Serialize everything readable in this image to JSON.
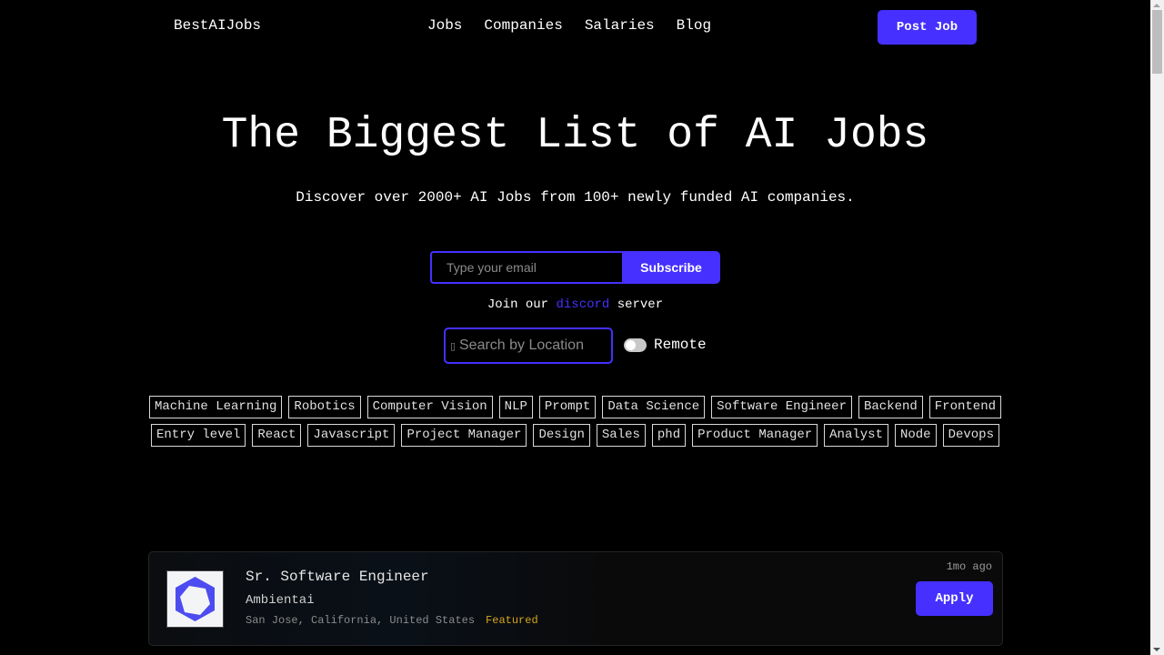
{
  "header": {
    "logo": "BestAIJobs",
    "nav": [
      {
        "label": "Jobs"
      },
      {
        "label": "Companies"
      },
      {
        "label": "Salaries"
      },
      {
        "label": "Blog"
      }
    ],
    "post_job_label": "Post Job"
  },
  "hero": {
    "title": "The Biggest List of AI Jobs",
    "subtitle": "Discover over 2000+ AI Jobs from 100+ newly funded AI companies."
  },
  "subscribe": {
    "email_placeholder": "Type your email",
    "email_value": "",
    "button_label": "Subscribe"
  },
  "discord": {
    "prefix": "Join our",
    "link": "discord",
    "suffix": "server"
  },
  "location_search": {
    "icon": "map-marker-icon",
    "placeholder": "Search by Location",
    "value": ""
  },
  "remote_toggle": {
    "label": "Remote",
    "checked": false
  },
  "tags": {
    "row1": [
      "Machine Learning",
      "Robotics",
      "Computer Vision",
      "NLP",
      "Prompt",
      "Data Science",
      "Software Engineer",
      "Backend",
      "Frontend"
    ],
    "row2": [
      "Entry level",
      "React",
      "Javascript",
      "Project Manager",
      "Design",
      "Sales",
      "phd",
      "Product Manager",
      "Analyst",
      "Node",
      "Devops"
    ]
  },
  "jobs": [
    {
      "title": "Sr. Software Engineer",
      "company": "Ambientai",
      "location": "San Jose, California, United States",
      "badge": "Featured",
      "posted": "1mo ago",
      "apply_label": "Apply",
      "logo_color": "#4c4cf0"
    }
  ],
  "colors": {
    "accent": "#4530ff",
    "featured": "#d4a51c",
    "background": "#000000"
  }
}
